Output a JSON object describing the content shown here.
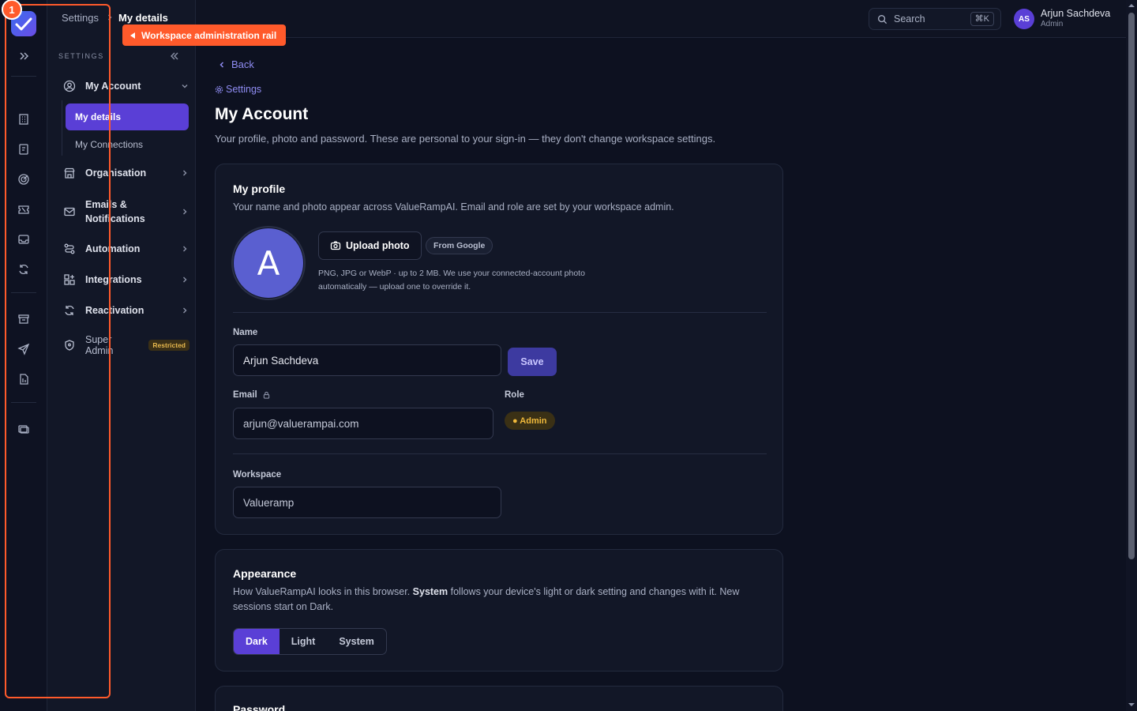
{
  "breadcrumb": {
    "parent": "Settings",
    "current": "My details"
  },
  "sidebar": {
    "section_label": "SETTINGS",
    "items": [
      {
        "label": "My Account"
      },
      {
        "label": "Organisation"
      },
      {
        "label": "Emails &",
        "label2": "Notifications"
      },
      {
        "label": "Automation"
      },
      {
        "label": "Integrations"
      },
      {
        "label": "Reactivation"
      },
      {
        "label": "Super Admin",
        "badge": "Restricted"
      }
    ],
    "subitems": [
      {
        "label": "My details"
      },
      {
        "label": "My Connections"
      }
    ]
  },
  "topbar": {
    "search_placeholder": "Search",
    "shortcut": "⌘K",
    "user_initials": "AS",
    "user_name": "Arjun Sachdeva",
    "user_role": "Admin"
  },
  "annotation": {
    "number": "1",
    "label": "Workspace administration rail"
  },
  "page": {
    "back": "Back",
    "settings_link": "Settings",
    "title": "My Account",
    "lead": "Your profile, photo and password. These are personal to your sign-in — they don't change workspace settings."
  },
  "profile": {
    "title": "My profile",
    "desc": "Your name and photo appear across ValueRampAI. Email and role are set by your workspace admin.",
    "avatar_letter": "A",
    "upload_label": "Upload photo",
    "google_label": "From Google",
    "hint": "PNG, JPG or WebP · up to 2 MB. We use your connected-account photo automatically — upload one to override it.",
    "name_label": "Name",
    "name_value": "Arjun Sachdeva",
    "save_label": "Save",
    "email_label": "Email",
    "email_value": "arjun@valuerampai.com",
    "role_label": "Role",
    "role_value": "● Admin",
    "workspace_label": "Workspace",
    "workspace_value": "Valueramp"
  },
  "appearance": {
    "title": "Appearance",
    "desc_a": "How ValueRampAI looks in this browser. ",
    "desc_b": "System",
    "desc_c": " follows your device's light or dark setting and changes with it. New sessions start on Dark.",
    "options": [
      "Dark",
      "Light",
      "System"
    ],
    "selected": "Dark"
  },
  "password": {
    "title": "Password"
  },
  "colors": {
    "accent": "#5a3fd6",
    "annotation": "#ff5a2b",
    "link": "#8f8cf2",
    "warning": "#f0b93b"
  }
}
